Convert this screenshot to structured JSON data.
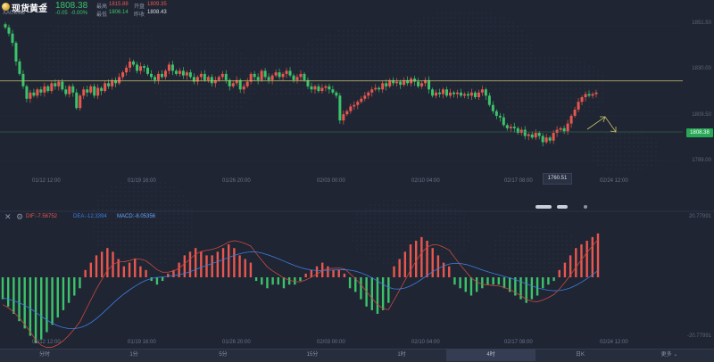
{
  "header": {
    "title": "现货黄金",
    "symbol": "XAUUSD",
    "price": "1808.38",
    "change": "-0.05",
    "change_pct": "-0.00%",
    "high_label": "最高",
    "high_value": "1815.88",
    "open_label": "开盘",
    "open_value": "1809.35",
    "low_label": "最低",
    "low_value": "1806.14",
    "prev_close_label": "昨收",
    "prev_close_value": "1808.43"
  },
  "price_axis": {
    "ticks": [
      "1851.50",
      "1830.00",
      "1809.50",
      "1789.00",
      "1768.50"
    ]
  },
  "price_tag": "1808.38",
  "low_marker": "1760.51",
  "x_ticks": [
    "01/12 12:00",
    "01/19 16:00",
    "01/26 20:00",
    "02/03 00:00",
    "02/10 04:00",
    "02/17 08:00",
    "02/24 12:00"
  ],
  "macd": {
    "dif_label": "DIF:-7.56752",
    "dea_label": "DEA:-12.3394",
    "macd_label": "MACD:-8.05356",
    "axis_top": "20.77991",
    "axis_bottom": "-20.77991"
  },
  "tabs": [
    "分时",
    "1分",
    "5分",
    "15分",
    "1时",
    "4时",
    "日K",
    "更多"
  ],
  "active_tab": "4时",
  "colors": {
    "up": "#e8574e",
    "down": "#3cc36a",
    "background": "#1f2533",
    "hline": "#c8c26a",
    "dif": "#e8574e",
    "dea": "#3d7ee0"
  },
  "chart_data": [
    {
      "type": "candlestick",
      "title": "现货黄金 XAUUSD",
      "interval": "4时",
      "ylim": [
        1755,
        1855
      ],
      "x_ticks": [
        "01/12 12:00",
        "01/19 16:00",
        "01/26 20:00",
        "02/03 00:00",
        "02/10 04:00",
        "02/17 08:00",
        "02/24 12:00"
      ],
      "close_series": [
        1850,
        1846,
        1840,
        1828,
        1820,
        1812,
        1804,
        1808,
        1806,
        1810,
        1808,
        1812,
        1809,
        1814,
        1812,
        1815,
        1810,
        1807,
        1812,
        1808,
        1798,
        1806,
        1810,
        1808,
        1812,
        1806,
        1811,
        1809,
        1814,
        1812,
        1816,
        1814,
        1818,
        1821,
        1824,
        1828,
        1826,
        1822,
        1825,
        1824,
        1820,
        1818,
        1816,
        1820,
        1818,
        1822,
        1826,
        1822,
        1820,
        1822,
        1819,
        1821,
        1818,
        1815,
        1818,
        1820,
        1816,
        1818,
        1814,
        1816,
        1818,
        1820,
        1816,
        1812,
        1814,
        1816,
        1810,
        1812,
        1815,
        1820,
        1818,
        1816,
        1822,
        1818,
        1816,
        1819,
        1821,
        1818,
        1820,
        1822,
        1819,
        1816,
        1818,
        1820,
        1816,
        1812,
        1810,
        1812,
        1809,
        1811,
        1812,
        1810,
        1808,
        1806,
        1790,
        1794,
        1796,
        1799,
        1800,
        1802,
        1804,
        1806,
        1808,
        1810,
        1811,
        1810,
        1814,
        1812,
        1816,
        1814,
        1815,
        1813,
        1816,
        1814,
        1817,
        1815,
        1812,
        1814,
        1816,
        1810,
        1806,
        1808,
        1807,
        1810,
        1806,
        1808,
        1807,
        1808,
        1806,
        1807,
        1806,
        1808,
        1805,
        1808,
        1810,
        1806,
        1800,
        1796,
        1793,
        1792,
        1787,
        1785,
        1786,
        1785,
        1782,
        1784,
        1780,
        1781,
        1779,
        1782,
        1780,
        1776,
        1779,
        1777,
        1782,
        1784,
        1785,
        1783,
        1788,
        1793,
        1797,
        1802,
        1805,
        1807,
        1806,
        1807,
        1808
      ],
      "reference_line": 1815.5,
      "last_price": 1808.38,
      "marked_low": 1760.51
    },
    {
      "type": "bar",
      "title": "MACD",
      "ylim": [
        -20.77991,
        20.77991
      ],
      "series": [
        {
          "name": "DIF",
          "value": -7.56752
        },
        {
          "name": "DEA",
          "value": -12.3394
        },
        {
          "name": "MACD",
          "value": -8.05356
        }
      ],
      "histogram": [
        -6,
        -8,
        -10,
        -12,
        -14,
        -16,
        -18,
        -17,
        -15,
        -13,
        -11,
        -9,
        -7,
        -5,
        -3,
        2,
        4,
        6,
        7,
        8,
        7,
        5,
        3,
        4,
        5,
        3,
        2,
        -1,
        -2,
        -1,
        1,
        2,
        4,
        6,
        7,
        8,
        7,
        6,
        6,
        7,
        8,
        9,
        8,
        6,
        5,
        4,
        -1,
        -2,
        -3,
        -2,
        -2,
        -3,
        -2,
        -2,
        -1,
        1,
        2,
        3,
        4,
        3,
        2,
        2,
        1,
        -3,
        -4,
        -6,
        -8,
        -9,
        -10,
        -9,
        -7,
        3,
        5,
        7,
        9,
        10,
        11,
        10,
        8,
        6,
        4,
        3,
        -2,
        -3,
        -4,
        -5,
        -4,
        -3,
        -2,
        -2,
        -2,
        -3,
        -4,
        -5,
        -6,
        -7,
        -6,
        -5,
        -3,
        -2,
        -1,
        2,
        4,
        6,
        8,
        9,
        10,
        11,
        12
      ]
    }
  ]
}
